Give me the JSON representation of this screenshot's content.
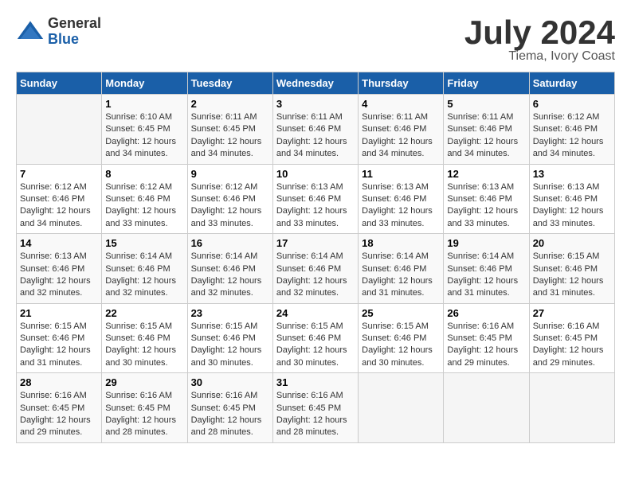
{
  "header": {
    "logo_line1": "General",
    "logo_line2": "Blue",
    "month": "July 2024",
    "location": "Tiema, Ivory Coast"
  },
  "weekdays": [
    "Sunday",
    "Monday",
    "Tuesday",
    "Wednesday",
    "Thursday",
    "Friday",
    "Saturday"
  ],
  "weeks": [
    [
      {
        "day": "",
        "info": ""
      },
      {
        "day": "1",
        "info": "Sunrise: 6:10 AM\nSunset: 6:45 PM\nDaylight: 12 hours\nand 34 minutes."
      },
      {
        "day": "2",
        "info": "Sunrise: 6:11 AM\nSunset: 6:45 PM\nDaylight: 12 hours\nand 34 minutes."
      },
      {
        "day": "3",
        "info": "Sunrise: 6:11 AM\nSunset: 6:46 PM\nDaylight: 12 hours\nand 34 minutes."
      },
      {
        "day": "4",
        "info": "Sunrise: 6:11 AM\nSunset: 6:46 PM\nDaylight: 12 hours\nand 34 minutes."
      },
      {
        "day": "5",
        "info": "Sunrise: 6:11 AM\nSunset: 6:46 PM\nDaylight: 12 hours\nand 34 minutes."
      },
      {
        "day": "6",
        "info": "Sunrise: 6:12 AM\nSunset: 6:46 PM\nDaylight: 12 hours\nand 34 minutes."
      }
    ],
    [
      {
        "day": "7",
        "info": "Sunrise: 6:12 AM\nSunset: 6:46 PM\nDaylight: 12 hours\nand 34 minutes."
      },
      {
        "day": "8",
        "info": "Sunrise: 6:12 AM\nSunset: 6:46 PM\nDaylight: 12 hours\nand 33 minutes."
      },
      {
        "day": "9",
        "info": "Sunrise: 6:12 AM\nSunset: 6:46 PM\nDaylight: 12 hours\nand 33 minutes."
      },
      {
        "day": "10",
        "info": "Sunrise: 6:13 AM\nSunset: 6:46 PM\nDaylight: 12 hours\nand 33 minutes."
      },
      {
        "day": "11",
        "info": "Sunrise: 6:13 AM\nSunset: 6:46 PM\nDaylight: 12 hours\nand 33 minutes."
      },
      {
        "day": "12",
        "info": "Sunrise: 6:13 AM\nSunset: 6:46 PM\nDaylight: 12 hours\nand 33 minutes."
      },
      {
        "day": "13",
        "info": "Sunrise: 6:13 AM\nSunset: 6:46 PM\nDaylight: 12 hours\nand 33 minutes."
      }
    ],
    [
      {
        "day": "14",
        "info": "Sunrise: 6:13 AM\nSunset: 6:46 PM\nDaylight: 12 hours\nand 32 minutes."
      },
      {
        "day": "15",
        "info": "Sunrise: 6:14 AM\nSunset: 6:46 PM\nDaylight: 12 hours\nand 32 minutes."
      },
      {
        "day": "16",
        "info": "Sunrise: 6:14 AM\nSunset: 6:46 PM\nDaylight: 12 hours\nand 32 minutes."
      },
      {
        "day": "17",
        "info": "Sunrise: 6:14 AM\nSunset: 6:46 PM\nDaylight: 12 hours\nand 32 minutes."
      },
      {
        "day": "18",
        "info": "Sunrise: 6:14 AM\nSunset: 6:46 PM\nDaylight: 12 hours\nand 31 minutes."
      },
      {
        "day": "19",
        "info": "Sunrise: 6:14 AM\nSunset: 6:46 PM\nDaylight: 12 hours\nand 31 minutes."
      },
      {
        "day": "20",
        "info": "Sunrise: 6:15 AM\nSunset: 6:46 PM\nDaylight: 12 hours\nand 31 minutes."
      }
    ],
    [
      {
        "day": "21",
        "info": "Sunrise: 6:15 AM\nSunset: 6:46 PM\nDaylight: 12 hours\nand 31 minutes."
      },
      {
        "day": "22",
        "info": "Sunrise: 6:15 AM\nSunset: 6:46 PM\nDaylight: 12 hours\nand 30 minutes."
      },
      {
        "day": "23",
        "info": "Sunrise: 6:15 AM\nSunset: 6:46 PM\nDaylight: 12 hours\nand 30 minutes."
      },
      {
        "day": "24",
        "info": "Sunrise: 6:15 AM\nSunset: 6:46 PM\nDaylight: 12 hours\nand 30 minutes."
      },
      {
        "day": "25",
        "info": "Sunrise: 6:15 AM\nSunset: 6:46 PM\nDaylight: 12 hours\nand 30 minutes."
      },
      {
        "day": "26",
        "info": "Sunrise: 6:16 AM\nSunset: 6:45 PM\nDaylight: 12 hours\nand 29 minutes."
      },
      {
        "day": "27",
        "info": "Sunrise: 6:16 AM\nSunset: 6:45 PM\nDaylight: 12 hours\nand 29 minutes."
      }
    ],
    [
      {
        "day": "28",
        "info": "Sunrise: 6:16 AM\nSunset: 6:45 PM\nDaylight: 12 hours\nand 29 minutes."
      },
      {
        "day": "29",
        "info": "Sunrise: 6:16 AM\nSunset: 6:45 PM\nDaylight: 12 hours\nand 28 minutes."
      },
      {
        "day": "30",
        "info": "Sunrise: 6:16 AM\nSunset: 6:45 PM\nDaylight: 12 hours\nand 28 minutes."
      },
      {
        "day": "31",
        "info": "Sunrise: 6:16 AM\nSunset: 6:45 PM\nDaylight: 12 hours\nand 28 minutes."
      },
      {
        "day": "",
        "info": ""
      },
      {
        "day": "",
        "info": ""
      },
      {
        "day": "",
        "info": ""
      }
    ]
  ]
}
